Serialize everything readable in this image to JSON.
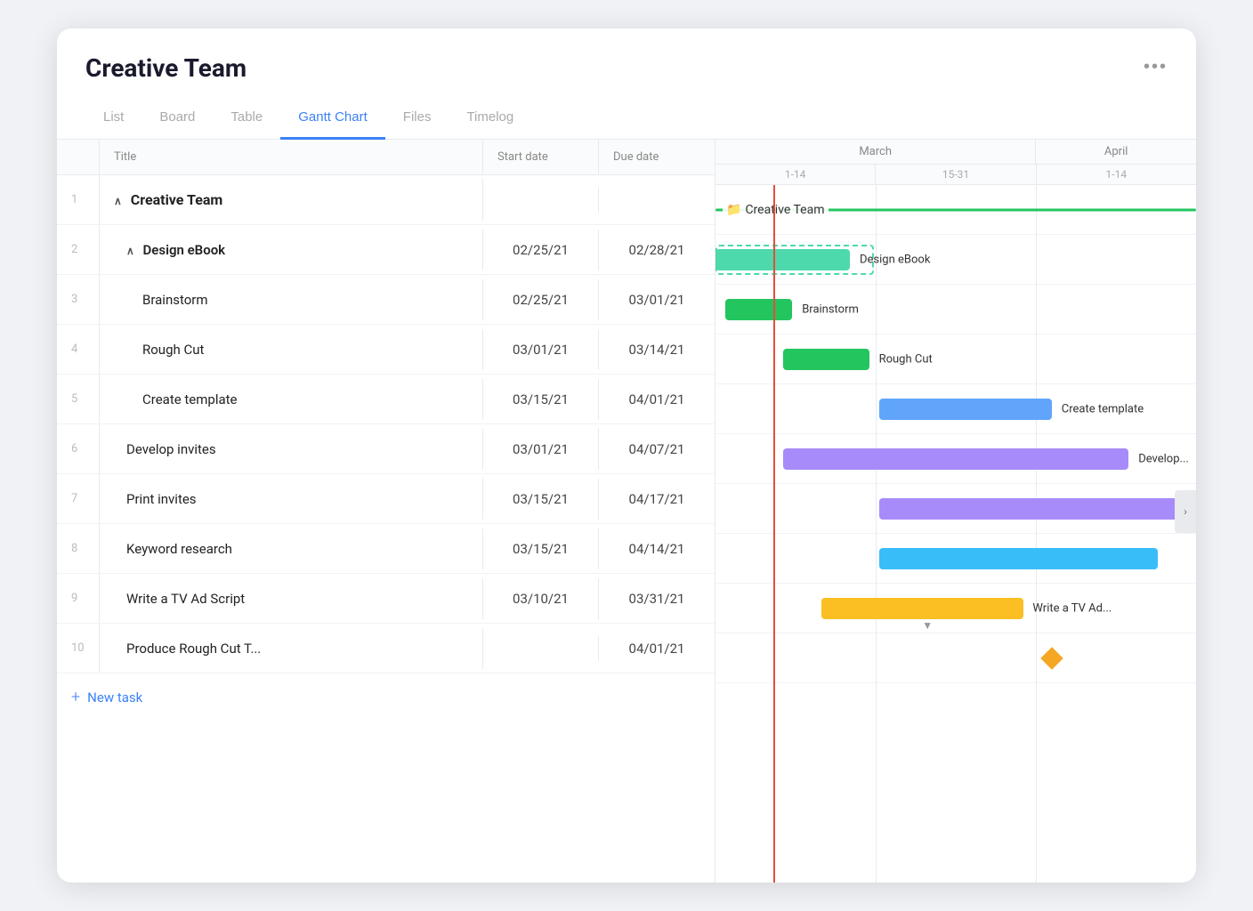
{
  "app": {
    "title": "Creative Team",
    "more_icon": "•••"
  },
  "tabs": [
    {
      "id": "list",
      "label": "List",
      "active": false
    },
    {
      "id": "board",
      "label": "Board",
      "active": false
    },
    {
      "id": "table",
      "label": "Table",
      "active": false
    },
    {
      "id": "gantt",
      "label": "Gantt Chart",
      "active": true
    },
    {
      "id": "files",
      "label": "Files",
      "active": false
    },
    {
      "id": "timelog",
      "label": "Timelog",
      "active": false
    }
  ],
  "table_headers": {
    "num": "",
    "title": "Title",
    "start": "Start date",
    "due": "Due date"
  },
  "rows": [
    {
      "num": "1",
      "title": "Creative Team",
      "start": "",
      "due": "",
      "type": "group",
      "indent": 0
    },
    {
      "num": "2",
      "title": "Design eBook",
      "start": "02/25/21",
      "due": "02/28/21",
      "type": "subgroup",
      "indent": 1
    },
    {
      "num": "3",
      "title": "Brainstorm",
      "start": "02/25/21",
      "due": "03/01/21",
      "type": "task",
      "indent": 2
    },
    {
      "num": "4",
      "title": "Rough Cut",
      "start": "03/01/21",
      "due": "03/14/21",
      "type": "task",
      "indent": 2
    },
    {
      "num": "5",
      "title": "Create template",
      "start": "03/15/21",
      "due": "04/01/21",
      "type": "task",
      "indent": 2
    },
    {
      "num": "6",
      "title": "Develop invites",
      "start": "03/01/21",
      "due": "04/07/21",
      "type": "task",
      "indent": 1
    },
    {
      "num": "7",
      "title": "Print invites",
      "start": "03/15/21",
      "due": "04/17/21",
      "type": "task",
      "indent": 1
    },
    {
      "num": "8",
      "title": "Keyword research",
      "start": "03/15/21",
      "due": "04/14/21",
      "type": "task",
      "indent": 1
    },
    {
      "num": "9",
      "title": "Write a TV Ad Script",
      "start": "03/10/21",
      "due": "03/31/21",
      "type": "task",
      "indent": 1
    },
    {
      "num": "10",
      "title": "Produce Rough Cut T...",
      "start": "",
      "due": "04/01/21",
      "type": "task",
      "indent": 1
    }
  ],
  "new_task_label": "New task",
  "gantt": {
    "months": [
      {
        "label": "March",
        "cols": 2
      },
      {
        "label": "April",
        "cols": 1
      }
    ],
    "periods": [
      "1-14",
      "15-31",
      "1-14"
    ],
    "colors": {
      "teal": "#4dd9ac",
      "green": "#22c55e",
      "blue": "#60a5fa",
      "purple": "#a78bfa",
      "yellow": "#fbbf24",
      "group_line": "#22c55e"
    }
  }
}
